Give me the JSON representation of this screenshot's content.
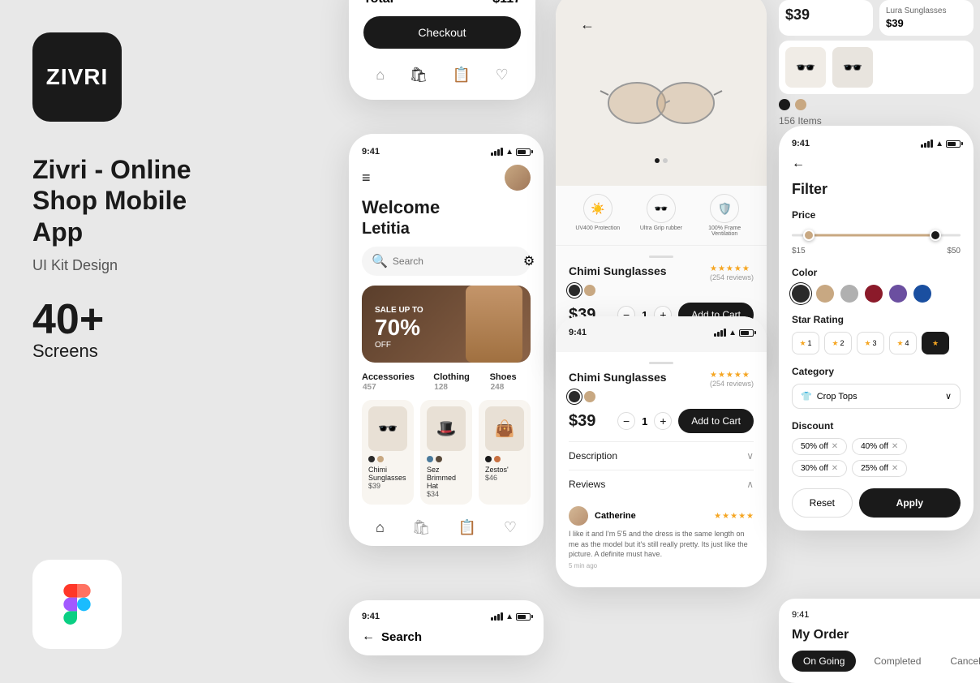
{
  "app": {
    "logo": "ZIVRI",
    "title": "Zivri - Online Shop Mobile App",
    "subtitle": "UI Kit Design",
    "screens_count": "40+",
    "screens_label": "Screens"
  },
  "phone1": {
    "total_label": "Total",
    "total_value": "$117",
    "checkout_label": "Checkout"
  },
  "phone2": {
    "time": "9:41",
    "welcome": "Welcome",
    "name": "Letitia",
    "search_placeholder": "Search",
    "sale_label": "SALE UP TO",
    "sale_percent": "70%",
    "sale_off": "OFF",
    "categories": [
      {
        "name": "Accessories",
        "count": "457"
      },
      {
        "name": "Clothing",
        "count": "128"
      },
      {
        "name": "Shoes",
        "count": "248"
      }
    ],
    "products": [
      {
        "name": "Chimi Sunglasses",
        "price": "$39"
      },
      {
        "name": "Sez Brimmed Hat",
        "price": "$34"
      },
      {
        "name": "Zestos'",
        "price": "$46"
      }
    ]
  },
  "phone3": {
    "product_name": "Chimi Sunglasses",
    "price": "$39",
    "reviews": "(254 reviews)",
    "quantity": "1",
    "add_to_cart": "Add to Cart",
    "description_label": "Description",
    "reviews_label": "Reviews",
    "reviewer_name": "Catherine",
    "review_text": "I like it and I'm 5'5 and the dress is the same length on me as the model but it's still really pretty. Its just like the picture. A definite must have.",
    "review_time": "5 min ago",
    "features": [
      {
        "icon": "☀️",
        "label": "UV400 Protection"
      },
      {
        "icon": "🕶️",
        "label": "Ultra Grip rubber"
      },
      {
        "icon": "🛡️",
        "label": "100% Frame Ventilation"
      }
    ]
  },
  "phone3b": {
    "product_name": "Chimi Sunglasses",
    "price": "$39",
    "reviews": "(254 reviews)",
    "quantity": "1",
    "add_to_cart": "Add to Cart"
  },
  "phone4": {
    "time": "9:41",
    "filter_title": "Filter",
    "price_label": "Price",
    "price_min": "$15",
    "price_max": "$50",
    "color_label": "Color",
    "star_label": "Star Rating",
    "category_label": "Category",
    "category_value": "Crop Tops",
    "discount_label": "Discount",
    "discounts": [
      "50% off",
      "40% off",
      "30% off",
      "25% off"
    ],
    "reset_label": "Reset",
    "apply_label": "Apply",
    "colors": [
      "#2a2a2a",
      "#c8a882",
      "#b0b0b0",
      "#8b1a2a",
      "#6b4fa0",
      "#1a4fa0"
    ]
  },
  "phone5": {
    "time": "9:41",
    "title": "My Order",
    "tabs": [
      "On Going",
      "Completed",
      "Cancelled"
    ]
  },
  "phone6": {
    "time": "9:41",
    "search_label": "Search"
  },
  "right_products": [
    {
      "price": "$39",
      "name": "Lura Sunglasses",
      "price2": "$39"
    }
  ]
}
